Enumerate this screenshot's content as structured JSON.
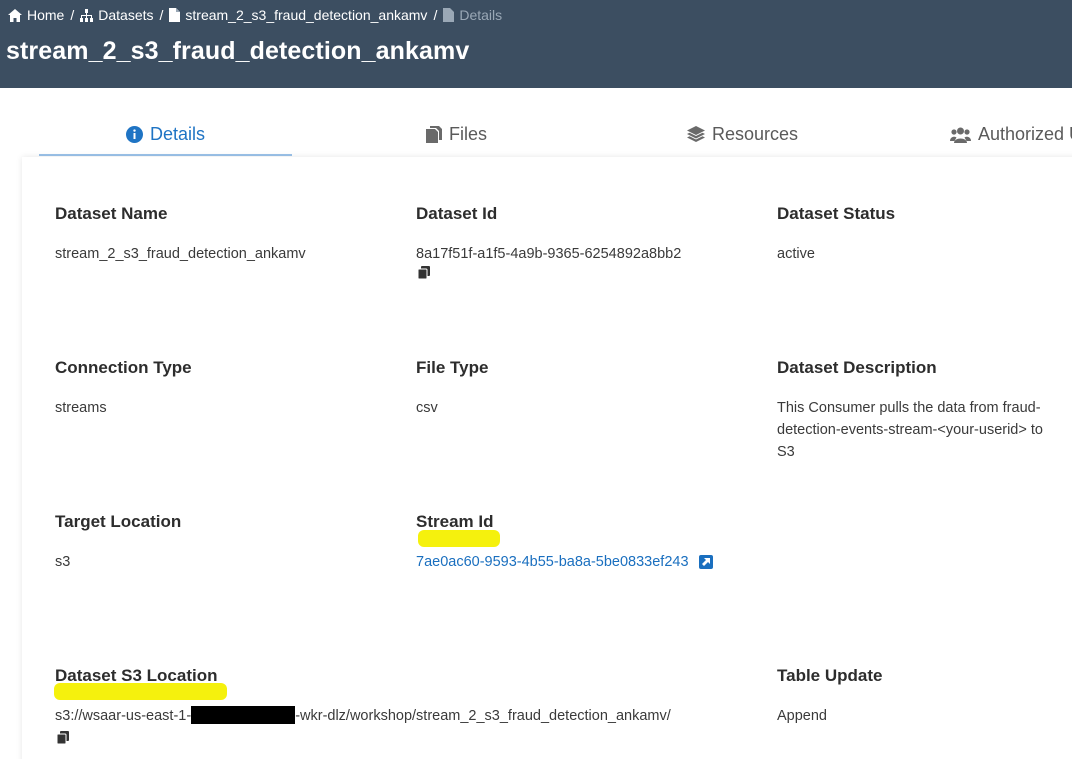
{
  "breadcrumb": {
    "home": "Home",
    "datasets": "Datasets",
    "dataset": "stream_2_s3_fraud_detection_ankamv",
    "current": "Details",
    "separator": "/"
  },
  "page_title": "stream_2_s3_fraud_detection_ankamv",
  "tabs": [
    {
      "label": "Details",
      "icon": "info-circle-icon"
    },
    {
      "label": "Files",
      "icon": "files-icon"
    },
    {
      "label": "Resources",
      "icon": "layers-icon"
    },
    {
      "label": "Authorized U",
      "icon": "users-icon"
    }
  ],
  "fields": {
    "dataset_name": {
      "label": "Dataset Name",
      "value": "stream_2_s3_fraud_detection_ankamv"
    },
    "dataset_id": {
      "label": "Dataset Id",
      "value": "8a17f51f-a1f5-4a9b-9365-6254892a8bb2"
    },
    "dataset_status": {
      "label": "Dataset Status",
      "value": "active"
    },
    "connection_type": {
      "label": "Connection Type",
      "value": "streams"
    },
    "file_type": {
      "label": "File Type",
      "value": "csv"
    },
    "dataset_description": {
      "label": "Dataset Description",
      "line1": "This Consumer pulls the data from fraud-",
      "line2": "detection-events-stream-<your-userid> to",
      "line3": "S3"
    },
    "target_location": {
      "label": "Target Location",
      "value": "s3"
    },
    "stream_id": {
      "label": "Stream Id",
      "value": "7ae0ac60-9593-4b55-ba8a-5be0833ef243"
    },
    "s3_location": {
      "label": "Dataset S3 Location",
      "prefix": "s3://wsaar-us-east-1-",
      "suffix": "-wkr-dlz/workshop/stream_2_s3_fraud_detection_ankamv/"
    },
    "table_update": {
      "label": "Table Update",
      "value": "Append"
    }
  },
  "colors": {
    "header_bg": "#3c4e61",
    "accent": "#1f74c4",
    "highlight": "#f4f000"
  }
}
